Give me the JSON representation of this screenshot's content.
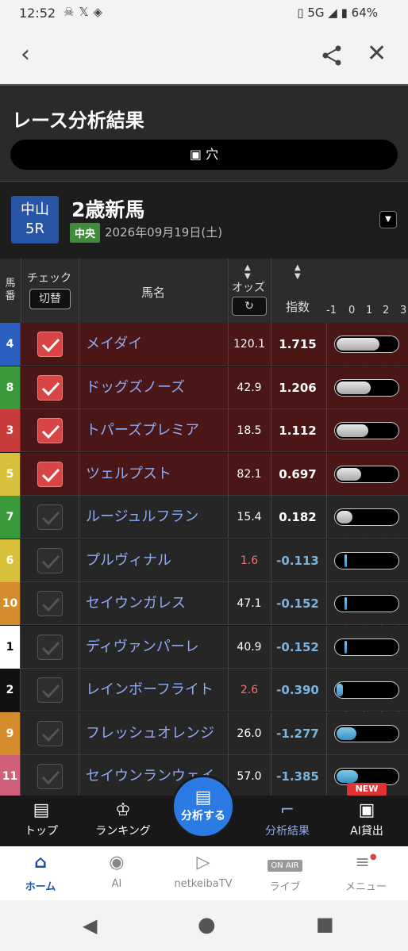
{
  "status": {
    "time": "12:52",
    "network": "5G",
    "battery": "64%"
  },
  "header": {
    "title": "レース分析結果",
    "mode": "穴"
  },
  "race": {
    "venue": "中山",
    "race_no": "5R",
    "name": "2歳新馬",
    "tag": "中央",
    "date": "2026年09月19日(土)"
  },
  "table": {
    "col_umaban": "馬番",
    "col_check": "チェック",
    "check_toggle": "切替",
    "col_name": "馬名",
    "col_odds": "オッズ",
    "col_index": "指数",
    "scale": [
      "-1",
      "0",
      "1",
      "2",
      "3"
    ],
    "rows": [
      {
        "num": "4",
        "color": "#2b5fbf",
        "checked": true,
        "name": "メイダイ",
        "odds": "120.1",
        "index": "1.715",
        "value": 1.715
      },
      {
        "num": "8",
        "color": "#3a9a3a",
        "checked": true,
        "name": "ドッグズノーズ",
        "odds": "42.9",
        "index": "1.206",
        "value": 1.206
      },
      {
        "num": "3",
        "color": "#c93b3b",
        "checked": true,
        "name": "トパーズプレミア",
        "odds": "18.5",
        "index": "1.112",
        "value": 1.112
      },
      {
        "num": "5",
        "color": "#d8c03a",
        "checked": true,
        "name": "ツェルプスト",
        "odds": "82.1",
        "index": "0.697",
        "value": 0.697
      },
      {
        "num": "7",
        "color": "#3a9a3a",
        "checked": false,
        "name": "ルージュルフラン",
        "odds": "15.4",
        "index": "0.182",
        "value": 0.182
      },
      {
        "num": "6",
        "color": "#d8c03a",
        "checked": false,
        "name": "プルヴィナル",
        "odds": "1.6",
        "index": "-0.113",
        "value": -0.113
      },
      {
        "num": "10",
        "color": "#d48b2c",
        "checked": false,
        "name": "セイウンガレス",
        "odds": "47.1",
        "index": "-0.152",
        "value": -0.152
      },
      {
        "num": "1",
        "color": "#ffffff",
        "checked": false,
        "name": "ディヴァンパーレ",
        "odds": "40.9",
        "index": "-0.152",
        "value": -0.152
      },
      {
        "num": "2",
        "color": "#111111",
        "checked": false,
        "name": "レインボーフライト",
        "odds": "2.6",
        "index": "-0.390",
        "value": -0.39
      },
      {
        "num": "9",
        "color": "#d48b2c",
        "checked": false,
        "name": "フレッシュオレンジ",
        "odds": "26.0",
        "index": "-1.277",
        "value": -1.277
      },
      {
        "num": "11",
        "color": "#d0607a",
        "checked": false,
        "name": "セイウンランウェイ",
        "odds": "57.0",
        "index": "-1.385",
        "value": -1.385
      }
    ]
  },
  "tabbar": {
    "top": "トップ",
    "ranking": "ランキング",
    "analyze": "分析する",
    "result": "分析結果",
    "ai": "AI貸出",
    "new_badge": "NEW"
  },
  "bottomnav": {
    "home": "ホーム",
    "ai": "AI",
    "tv": "netkeibaTV",
    "live": "ライブ",
    "live_badge": "ON AIR",
    "menu": "メニュー"
  }
}
